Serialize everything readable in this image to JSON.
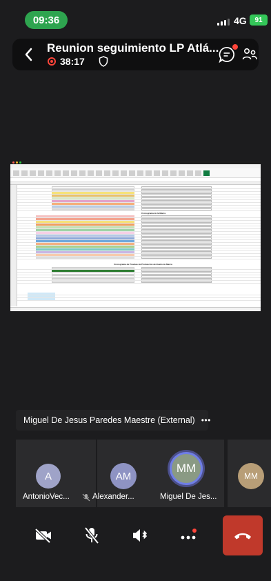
{
  "status_bar": {
    "time": "09:36",
    "network": "4G",
    "battery": "91"
  },
  "meeting": {
    "title": "Reunion seguimiento LP Atlá...",
    "duration": "38:17"
  },
  "shared_screen": {
    "sections": [
      "Cronograma de la Marca",
      "Cronograma de Pruebas de Producción de Boeilo de Marca"
    ]
  },
  "presenter_label": "Miguel De Jesus Paredes Maestre (External)",
  "more_glyph": "•••",
  "participants": [
    {
      "initials": "A",
      "name": "AntonioVec...",
      "color": "#9fa3c8",
      "muted": true
    },
    {
      "initials": "AM",
      "name": "Alexander...",
      "color": "#8e93c3",
      "muted": true
    },
    {
      "initials": "MM",
      "name": "Miguel De Jes...",
      "color": "#8a9a84",
      "muted": false,
      "speaking": true
    },
    {
      "initials": "MM",
      "name": "",
      "color": "#b89e77",
      "muted": false
    }
  ],
  "colors": {
    "accent_green": "#2ea44f",
    "hangup_red": "#c0392b",
    "recording_red": "#ff453a"
  },
  "icons": [
    "back-chevron-icon",
    "recording-icon",
    "shield-icon",
    "chat-icon",
    "participants-icon",
    "camera-off-icon",
    "mic-off-icon",
    "speaker-bluetooth-icon",
    "more-icon",
    "hang-up-icon"
  ]
}
